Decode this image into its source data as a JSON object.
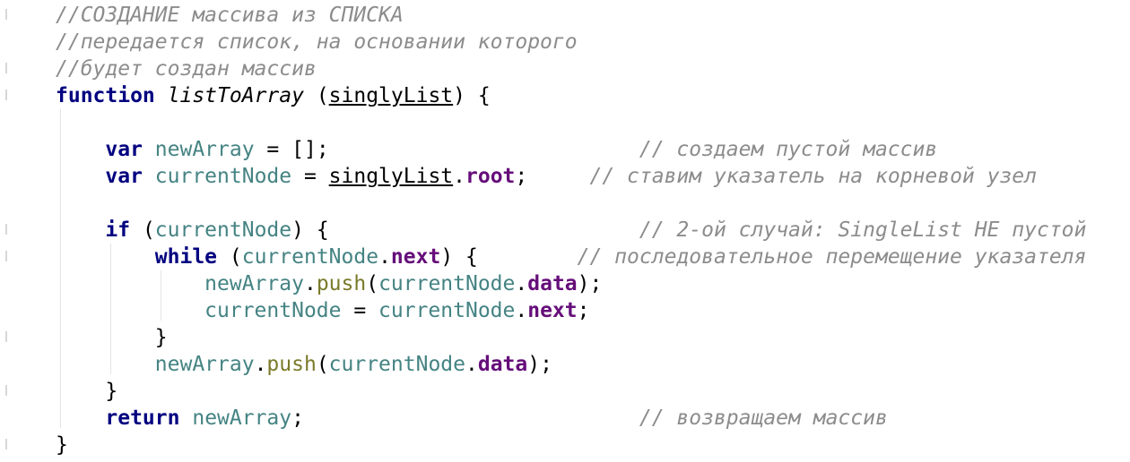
{
  "editor": {
    "lines": [
      {
        "id": "l1",
        "tokens": [
          {
            "t": "comment",
            "v": "//СОЗДАНИЕ массива из СПИСКА"
          }
        ]
      },
      {
        "id": "l2",
        "tokens": [
          {
            "t": "comment",
            "v": "//передается список, на основании которого"
          }
        ]
      },
      {
        "id": "l3",
        "tokens": [
          {
            "t": "comment",
            "v": "//будет создан массив"
          }
        ]
      },
      {
        "id": "l4",
        "tokens": [
          {
            "t": "kw",
            "v": "function"
          },
          {
            "t": "punct",
            "v": " "
          },
          {
            "t": "fn",
            "v": "listToArray"
          },
          {
            "t": "punct",
            "v": " ("
          },
          {
            "t": "param",
            "v": "singlyList"
          },
          {
            "t": "punct",
            "v": ") {"
          }
        ]
      },
      {
        "id": "l5",
        "tokens": []
      },
      {
        "id": "l6",
        "tokens": [
          {
            "t": "punct",
            "v": "    "
          },
          {
            "t": "kw",
            "v": "var"
          },
          {
            "t": "punct",
            "v": " "
          },
          {
            "t": "var",
            "v": "newArray"
          },
          {
            "t": "punct",
            "v": " = [];                         "
          },
          {
            "t": "comment",
            "v": "// создаем пустой массив"
          }
        ]
      },
      {
        "id": "l7",
        "tokens": [
          {
            "t": "punct",
            "v": "    "
          },
          {
            "t": "kw",
            "v": "var"
          },
          {
            "t": "punct",
            "v": " "
          },
          {
            "t": "var",
            "v": "currentNode"
          },
          {
            "t": "punct",
            "v": " = "
          },
          {
            "t": "param",
            "v": "singlyList"
          },
          {
            "t": "punct",
            "v": "."
          },
          {
            "t": "prop",
            "v": "root"
          },
          {
            "t": "punct",
            "v": ";     "
          },
          {
            "t": "comment",
            "v": "// ставим указатель на корневой узел"
          }
        ]
      },
      {
        "id": "l8",
        "tokens": []
      },
      {
        "id": "l9",
        "tokens": [
          {
            "t": "punct",
            "v": "    "
          },
          {
            "t": "kw",
            "v": "if"
          },
          {
            "t": "punct",
            "v": " ("
          },
          {
            "t": "var",
            "v": "currentNode"
          },
          {
            "t": "punct",
            "v": ") {                         "
          },
          {
            "t": "comment",
            "v": "// 2-ой случай: SingleList НЕ пустой"
          }
        ]
      },
      {
        "id": "l10",
        "tokens": [
          {
            "t": "punct",
            "v": "        "
          },
          {
            "t": "kw",
            "v": "while"
          },
          {
            "t": "punct",
            "v": " ("
          },
          {
            "t": "var",
            "v": "currentNode"
          },
          {
            "t": "punct",
            "v": "."
          },
          {
            "t": "prop",
            "v": "next"
          },
          {
            "t": "punct",
            "v": ") {        "
          },
          {
            "t": "comment",
            "v": "// последовательное перемещение указателя"
          }
        ]
      },
      {
        "id": "l11",
        "tokens": [
          {
            "t": "punct",
            "v": "            "
          },
          {
            "t": "var",
            "v": "newArray"
          },
          {
            "t": "punct",
            "v": "."
          },
          {
            "t": "method",
            "v": "push"
          },
          {
            "t": "punct",
            "v": "("
          },
          {
            "t": "var",
            "v": "currentNode"
          },
          {
            "t": "punct",
            "v": "."
          },
          {
            "t": "prop",
            "v": "data"
          },
          {
            "t": "punct",
            "v": ");"
          }
        ]
      },
      {
        "id": "l12",
        "tokens": [
          {
            "t": "punct",
            "v": "            "
          },
          {
            "t": "var",
            "v": "currentNode"
          },
          {
            "t": "punct",
            "v": " = "
          },
          {
            "t": "var",
            "v": "currentNode"
          },
          {
            "t": "punct",
            "v": "."
          },
          {
            "t": "prop",
            "v": "next"
          },
          {
            "t": "punct",
            "v": ";"
          }
        ]
      },
      {
        "id": "l13",
        "tokens": [
          {
            "t": "punct",
            "v": "        }"
          }
        ]
      },
      {
        "id": "l14",
        "tokens": [
          {
            "t": "punct",
            "v": "        "
          },
          {
            "t": "var",
            "v": "newArray"
          },
          {
            "t": "punct",
            "v": "."
          },
          {
            "t": "method",
            "v": "push"
          },
          {
            "t": "punct",
            "v": "("
          },
          {
            "t": "var",
            "v": "currentNode"
          },
          {
            "t": "punct",
            "v": "."
          },
          {
            "t": "prop",
            "v": "data"
          },
          {
            "t": "punct",
            "v": ");"
          }
        ]
      },
      {
        "id": "l15",
        "tokens": [
          {
            "t": "punct",
            "v": "    }"
          }
        ]
      },
      {
        "id": "l16",
        "tokens": [
          {
            "t": "punct",
            "v": "    "
          },
          {
            "t": "kw",
            "v": "return"
          },
          {
            "t": "punct",
            "v": " "
          },
          {
            "t": "var",
            "v": "newArray"
          },
          {
            "t": "punct",
            "v": ";                           "
          },
          {
            "t": "comment",
            "v": "// возвращаем массив"
          }
        ]
      },
      {
        "id": "l17",
        "tokens": [
          {
            "t": "punct",
            "v": "}"
          }
        ]
      }
    ]
  },
  "colors": {
    "comment": "#8c8c8c",
    "keyword": "#000080",
    "variable": "#458383",
    "property": "#660e7a",
    "method": "#7a7a2b"
  }
}
